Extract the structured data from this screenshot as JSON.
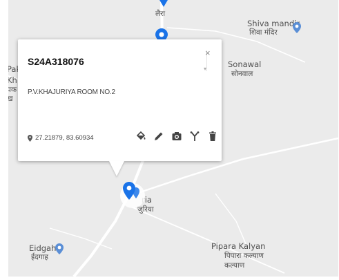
{
  "map": {
    "places": [
      {
        "name_en": "Shiva mandir",
        "name_hi": "शिवा मंदिर"
      },
      {
        "name_en": "Sonawal",
        "name_hi": "सोनवाल"
      },
      {
        "name_en": "Pipara Kalyan",
        "name_hi": "पिपारा कल्याण"
      },
      {
        "name_en": "Eidgah",
        "name_hi": "ईदगाह"
      },
      {
        "name_en": "Paka",
        "name_hi": "पक"
      },
      {
        "name_en": "ria",
        "name_hi": "जुरिया"
      },
      {
        "name_en": "",
        "name_hi": "लैरा"
      }
    ],
    "colors": {
      "marker": "#1a73e8",
      "place_icon": "#5b8fd6",
      "road": "#ffffff",
      "land": "#ebebeb"
    }
  },
  "popup": {
    "title": "S24A318076",
    "subtitle": "P.V.KHAJURIYA ROOM NO.2",
    "coordinates": "27.21879, 83.60934",
    "close_label": "×",
    "actions": [
      "paint-bucket-icon",
      "edit-pencil-icon",
      "camera-icon",
      "fork-icon",
      "trash-icon"
    ]
  }
}
